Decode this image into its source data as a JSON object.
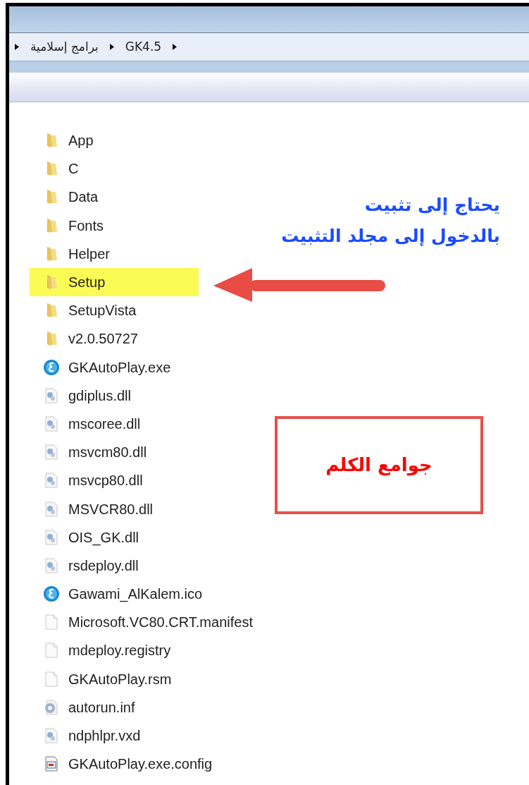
{
  "breadcrumb": [
    {
      "label": "برامج إسلامية"
    },
    {
      "label": "GK4.5"
    }
  ],
  "files": [
    {
      "name": "App",
      "kind": "folder",
      "highlighted": false
    },
    {
      "name": "C",
      "kind": "folder",
      "highlighted": false
    },
    {
      "name": "Data",
      "kind": "folder",
      "highlighted": false
    },
    {
      "name": "Fonts",
      "kind": "folder",
      "highlighted": false
    },
    {
      "name": "Helper",
      "kind": "folder",
      "highlighted": false
    },
    {
      "name": "Setup",
      "kind": "folder",
      "highlighted": true
    },
    {
      "name": "SetupVista",
      "kind": "folder",
      "highlighted": false
    },
    {
      "name": "v2.0.50727",
      "kind": "folder",
      "highlighted": false
    },
    {
      "name": "GKAutoPlay.exe",
      "kind": "app",
      "highlighted": false
    },
    {
      "name": "gdiplus.dll",
      "kind": "library",
      "highlighted": false
    },
    {
      "name": "mscoree.dll",
      "kind": "library",
      "highlighted": false
    },
    {
      "name": "msvcm80.dll",
      "kind": "library",
      "highlighted": false
    },
    {
      "name": "msvcp80.dll",
      "kind": "library",
      "highlighted": false
    },
    {
      "name": "MSVCR80.dll",
      "kind": "library",
      "highlighted": false
    },
    {
      "name": "OIS_GK.dll",
      "kind": "library",
      "highlighted": false
    },
    {
      "name": "rsdeploy.dll",
      "kind": "library",
      "highlighted": false
    },
    {
      "name": "Gawami_AlKalem.ico",
      "kind": "app",
      "highlighted": false
    },
    {
      "name": "Microsoft.VC80.CRT.manifest",
      "kind": "blank",
      "highlighted": false
    },
    {
      "name": "mdeploy.registry",
      "kind": "blank",
      "highlighted": false
    },
    {
      "name": "GKAutoPlay.rsm",
      "kind": "blank",
      "highlighted": false
    },
    {
      "name": "autorun.inf",
      "kind": "settings",
      "highlighted": false
    },
    {
      "name": "ndphlpr.vxd",
      "kind": "library",
      "highlighted": false
    },
    {
      "name": "GKAutoPlay.exe.config",
      "kind": "config",
      "highlighted": false
    }
  ],
  "annotations": {
    "note": [
      "يحتاج إلى تثبيت",
      "بالدخول إلى مجلد التثبيت"
    ],
    "box_label": "جوامع الكلم"
  }
}
